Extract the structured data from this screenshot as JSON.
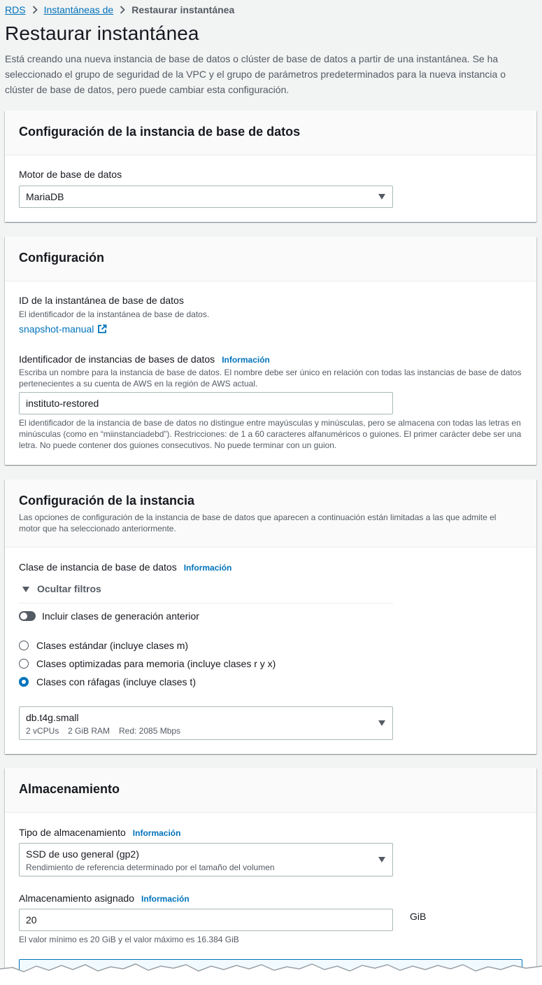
{
  "breadcrumb": {
    "root": "RDS",
    "parent": "Instantáneas de",
    "current": "Restaurar instantánea"
  },
  "page": {
    "title": "Restaurar instantánea",
    "description": "Está creando una nueva instancia de base de datos o clúster de base de datos a partir de una instantánea. Se ha seleccionado el grupo de seguridad de la VPC y el grupo de parámetros predeterminados para la nueva instancia o clúster de base de datos, pero puede cambiar esta configuración."
  },
  "db_instance_config": {
    "title": "Configuración de la instancia de base de datos",
    "engine_label": "Motor de base de datos",
    "engine_value": "MariaDB"
  },
  "settings": {
    "title": "Configuración",
    "snapshot_id_label": "ID de la instantánea de base de datos",
    "snapshot_id_desc": "El identificador de la instantánea de base de datos.",
    "snapshot_id_value": "snapshot-manual",
    "instance_id_label": "Identificador de instancias de bases de datos",
    "info": "Información",
    "instance_id_desc": "Escriba un nombre para la instancia de base de datos. El nombre debe ser único en relación con todas las instancias de base de datos pertenecientes a su cuenta de AWS en la región de AWS actual.",
    "instance_id_value": "instituto-restored",
    "instance_id_constraints": "El identificador de la instancia de base de datos no distingue entre mayúsculas y minúsculas, pero se almacena con todas las letras en minúsculas (como en “miinstanciadebd”). Restricciones: de 1 a 60 caracteres alfanuméricos o guiones. El primer carácter debe ser una letra. No puede contener dos guiones consecutivos. No puede terminar con un guion."
  },
  "instance_config": {
    "title": "Configuración de la instancia",
    "subtitle": "Las opciones de configuración de la instancia de base de datos que aparecen a continuación están limitadas a las que admite el motor que ha seleccionado anteriormente.",
    "class_label": "Clase de instancia de base de datos",
    "info": "Información",
    "hide_filters": "Ocultar filtros",
    "include_previous": "Incluir clases de generación anterior",
    "include_previous_on": false,
    "radios": [
      {
        "label": "Clases estándar (incluye clases m)",
        "selected": false
      },
      {
        "label": "Clases optimizadas para memoria (incluye clases r y x)",
        "selected": false
      },
      {
        "label": "Clases con ráfagas (incluye clases t)",
        "selected": true
      }
    ],
    "class_value": "db.t4g.small",
    "class_specs": {
      "vcpu": "2 vCPUs",
      "ram": "2 GiB RAM",
      "net": "Red: 2085 Mbps"
    }
  },
  "storage": {
    "title": "Almacenamiento",
    "type_label": "Tipo de almacenamiento",
    "info": "Información",
    "type_value": "SSD de uso general (gp2)",
    "type_desc": "Rendimiento de referencia determinado por el tamaño del volumen",
    "allocated_label": "Almacenamiento asignado",
    "allocated_value": "20",
    "unit": "GiB",
    "allocated_hint": "El valor mínimo es 20 GiB y el valor máximo es 16.384 GiB"
  },
  "colors": {
    "link": "#0073bb",
    "text": "#16191f",
    "muted": "#545b64",
    "background": "#f2f3f3"
  }
}
